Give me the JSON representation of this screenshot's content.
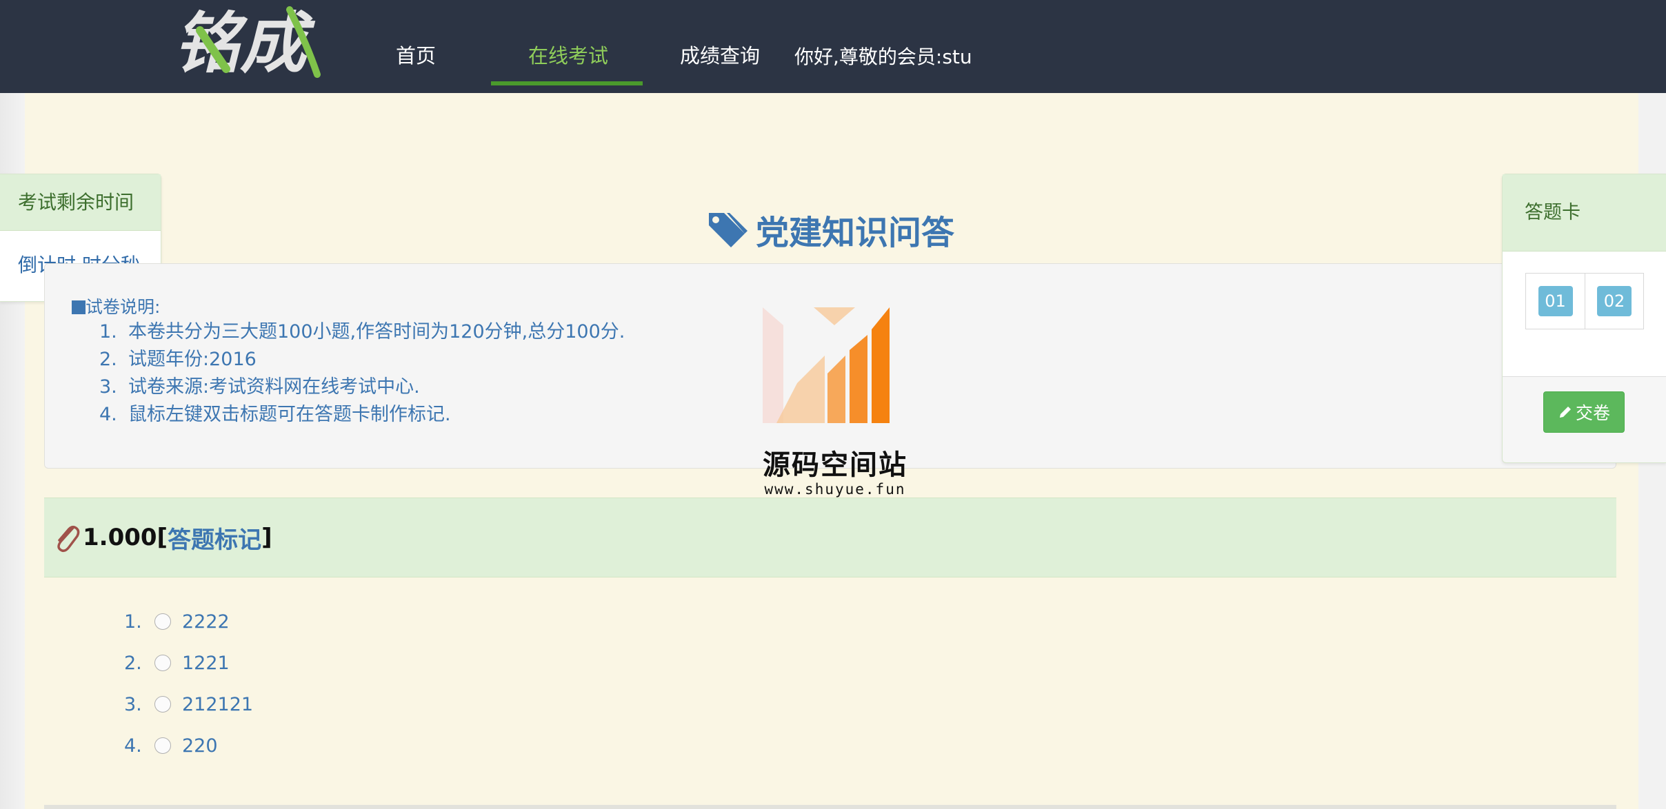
{
  "nav": {
    "logo_text": "铭成",
    "items": [
      {
        "label": "首页",
        "active": false
      },
      {
        "label": "在线考试",
        "active": true
      },
      {
        "label": "成绩查询",
        "active": false
      }
    ],
    "greeting": "你好,尊敬的会员:stu"
  },
  "timer": {
    "title": "考试剩余时间",
    "countdown": "倒计时 时分秒"
  },
  "exam": {
    "title": "党建知识问答",
    "info_heading": "试卷说明:",
    "info_items": [
      {
        "num": "1.",
        "text": "本卷共分为三大题100小题,作答时间为120分钟,总分100分."
      },
      {
        "num": "2.",
        "text": "试题年份:2016"
      },
      {
        "num": "3.",
        "text": "试卷来源:考试资料网在线考试中心."
      },
      {
        "num": "4.",
        "text": "鼠标左键双击标题可在答题卡制作标记."
      }
    ]
  },
  "watermark": {
    "name": "源码空间站",
    "url": "www.shuyue.fun"
  },
  "question": {
    "number": "1.000",
    "bracket_open": "[",
    "mark_label": "答题标记",
    "bracket_close": "]",
    "options": [
      {
        "num": "1.",
        "text": "2222"
      },
      {
        "num": "2.",
        "text": "1221"
      },
      {
        "num": "3.",
        "text": "212121"
      },
      {
        "num": "4.",
        "text": "220"
      }
    ]
  },
  "answer_card": {
    "title": "答题卡",
    "cells": [
      "01",
      "02"
    ],
    "submit_label": "交卷"
  },
  "colors": {
    "navbar": "#2c3444",
    "nav_active": "#8fcd5a",
    "accent_blue": "#3d76b1",
    "panel_green": "#dff0d8",
    "submit_green": "#5cb85c",
    "card_cell_blue": "#6fbbd9"
  }
}
